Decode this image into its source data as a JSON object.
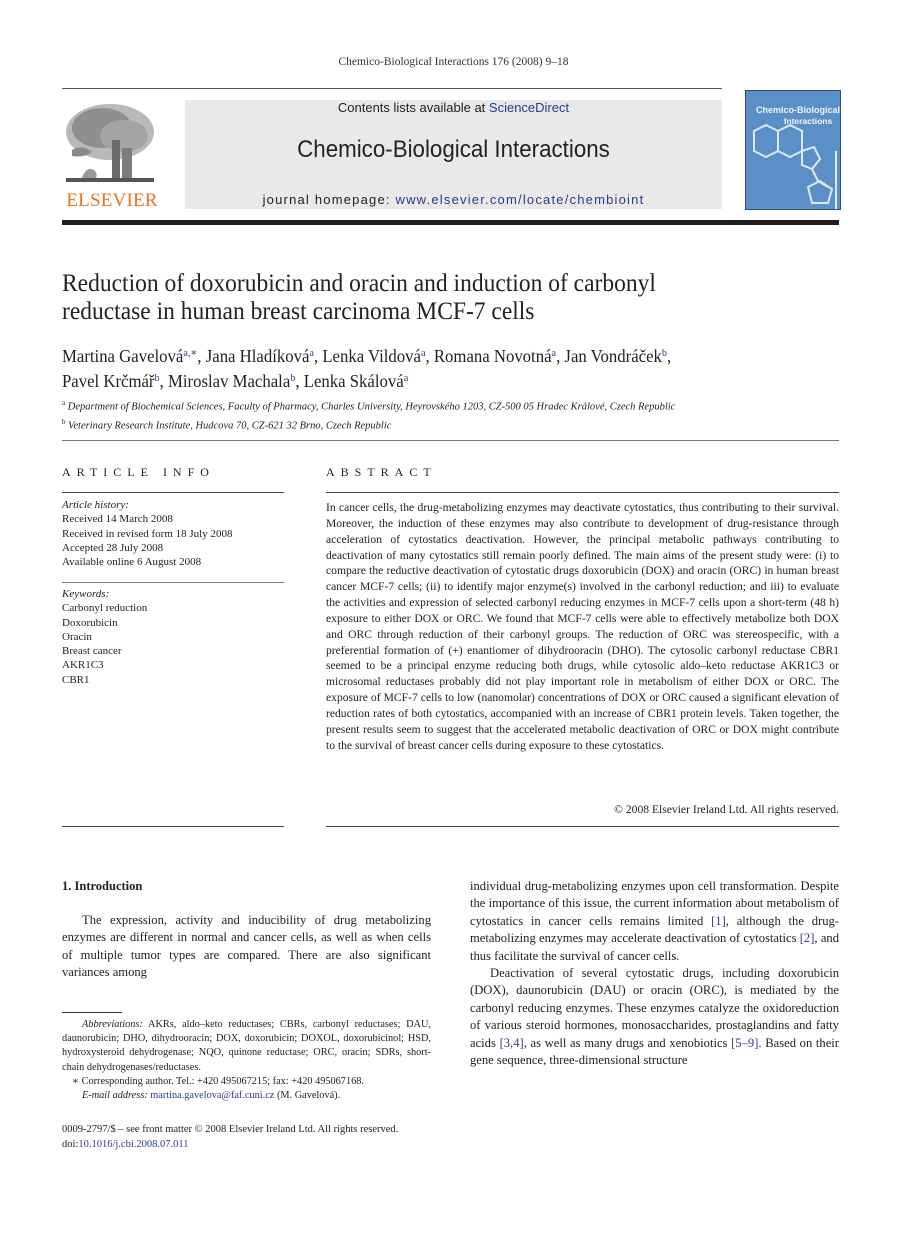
{
  "running_head": "Chemico-Biological Interactions 176 (2008) 9–18",
  "header": {
    "publisher_logo_text": "ELSEVIER",
    "contents_prefix": "Contents lists available at ",
    "contents_link": "ScienceDirect",
    "journal_title": "Chemico-Biological Interactions",
    "homepage_prefix": "journal homepage: ",
    "homepage_url": "www.elsevier.com/locate/chembioint",
    "cover_title_line1": "Chemico-Biological",
    "cover_title_line2": "Interactions",
    "colors": {
      "elsevier_orange": "#e8731e",
      "link_blue": "#2a3a8c",
      "cover_blue": "#5b8fc7",
      "banner_gray": "#e9e9e9"
    }
  },
  "article": {
    "title_line1": "Reduction of doxorubicin and oracin and induction of carbonyl",
    "title_line2": "reductase in human breast carcinoma MCF-7 cells",
    "authors": [
      {
        "name": "Martina Gavelová",
        "sup": "a,∗",
        "sep": ", "
      },
      {
        "name": "Jana Hladíková",
        "sup": "a",
        "sep": ", "
      },
      {
        "name": "Lenka Vildová",
        "sup": "a",
        "sep": ", "
      },
      {
        "name": "Romana Novotná",
        "sup": "a",
        "sep": ", "
      },
      {
        "name": "Jan Vondráček",
        "sup": "b",
        "sep": ", "
      },
      {
        "name": "Pavel Krčmář",
        "sup": "b",
        "sep": ", "
      },
      {
        "name": "Miroslav Machala",
        "sup": "b",
        "sep": ", "
      },
      {
        "name": "Lenka Skálová",
        "sup": "a",
        "sep": ""
      }
    ],
    "affiliations": [
      {
        "key": "a",
        "text": "Department of Biochemical Sciences, Faculty of Pharmacy, Charles University, Heyrovského 1203, CZ-500 05 Hradec Králové, Czech Republic"
      },
      {
        "key": "b",
        "text": "Veterinary Research Institute, Hudcova 70, CZ-621 32 Brno, Czech Republic"
      }
    ]
  },
  "article_info": {
    "heading": "ARTICLE INFO",
    "history_label": "Article history:",
    "history": [
      "Received 14 March 2008",
      "Received in revised form 18 July 2008",
      "Accepted 28 July 2008",
      "Available online 6 August 2008"
    ],
    "keywords_label": "Keywords:",
    "keywords": [
      "Carbonyl reduction",
      "Doxorubicin",
      "Oracin",
      "Breast cancer",
      "AKR1C3",
      "CBR1"
    ]
  },
  "abstract": {
    "heading": "ABSTRACT",
    "text": "In cancer cells, the drug-metabolizing enzymes may deactivate cytostatics, thus contributing to their survival. Moreover, the induction of these enzymes may also contribute to development of drug-resistance through acceleration of cytostatics deactivation. However, the principal metabolic pathways contributing to deactivation of many cytostatics still remain poorly defined. The main aims of the present study were: (i) to compare the reductive deactivation of cytostatic drugs doxorubicin (DOX) and oracin (ORC) in human breast cancer MCF-7 cells; (ii) to identify major enzyme(s) involved in the carbonyl reduction; and iii) to evaluate the activities and expression of selected carbonyl reducing enzymes in MCF-7 cells upon a short-term (48 h) exposure to either DOX or ORC. We found that MCF-7 cells were able to effectively metabolize both DOX and ORC through reduction of their carbonyl groups. The reduction of ORC was stereospecific, with a preferential formation of (+) enantiomer of dihydrooracin (DHO). The cytosolic carbonyl reductase CBR1 seemed to be a principal enzyme reducing both drugs, while cytosolic aldo–keto reductase AKR1C3 or microsomal reductases probably did not play important role in metabolism of either DOX or ORC. The exposure of MCF-7 cells to low (nanomolar) concentrations of DOX or ORC caused a significant elevation of reduction rates of both cytostatics, accompanied with an increase of CBR1 protein levels. Taken together, the present results seem to suggest that the accelerated metabolic deactivation of ORC or DOX might contribute to the survival of breast cancer cells during exposure to these cytostatics.",
    "copyright": "© 2008 Elsevier Ireland Ltd. All rights reserved."
  },
  "body": {
    "section_heading": "1.  Introduction",
    "left_para": "The expression, activity and inducibility of drug metabolizing enzymes are different in normal and cancer cells, as well as when cells of multiple tumor types are compared. There are also significant variances among",
    "right_para1": {
      "t1": "individual drug-metabolizing enzymes upon cell transformation. Despite the importance of this issue, the current information about metabolism of cytostatics in cancer cells remains limited ",
      "r1": "[1]",
      "t2": ", although the drug-metabolizing enzymes may accelerate deactivation of cytostatics ",
      "r2": "[2]",
      "t3": ", and thus facilitate the survival of cancer cells."
    },
    "right_para2": {
      "t1": "Deactivation of several cytostatic drugs, including doxorubicin (DOX), daunorubicin (DAU) or oracin (ORC), is mediated by the carbonyl reducing enzymes. These enzymes catalyze the oxidoreduction of various steroid hormones, monosaccharides, prostaglandins and fatty acids ",
      "r1": "[3,4]",
      "t2": ", as well as many drugs and xenobiotics ",
      "r2": "[5–9]",
      "t3": ". Based on their gene sequence, three-dimensional structure"
    }
  },
  "footnotes": {
    "abbrev_label": "Abbreviations:",
    "abbrev_text": "  AKRs, aldo–keto reductases; CBRs, carbonyl reductases; DAU, daunorubicin; DHO, dihydrooracin; DOX, doxorubicin; DOXOL, doxorubicinol; HSD, hydroxysteroid dehydrogenase; NQO, quinone reductase; ORC, oracin; SDRs, short-chain dehydrogenases/reductases.",
    "corresponding": "∗  Corresponding author. Tel.: +420 495067215; fax: +420 495067168.",
    "email_label": "E-mail address:",
    "email": "martina.gavelova@faf.cuni.cz",
    "email_suffix": " (M. Gavelová)."
  },
  "front_matter": {
    "issn_line": "0009-2797/$ – see front matter © 2008 Elsevier Ireland Ltd. All rights reserved.",
    "doi_prefix": "doi:",
    "doi": "10.1016/j.cbi.2008.07.011"
  }
}
